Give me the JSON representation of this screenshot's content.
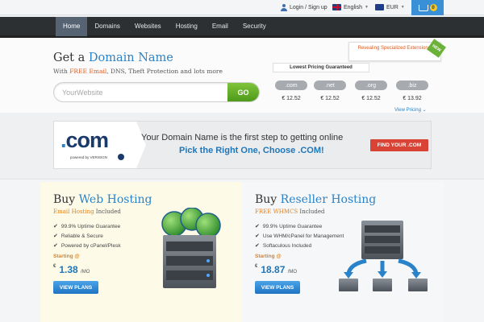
{
  "topbar": {
    "login": "Login / Sign up",
    "language": "English",
    "currency": "EUR",
    "cart_count": "0"
  },
  "nav": {
    "items": [
      "Home",
      "Domains",
      "Websites",
      "Hosting",
      "Email",
      "Security"
    ],
    "active": "Home"
  },
  "domain": {
    "title_pre": "Get a",
    "title_accent": "Domain Name",
    "sub_pre": "With",
    "sub_red": "FREE Email",
    "sub_post": ", DNS, Theft Protection and lots more",
    "search_placeholder": "YourWebsite",
    "go_label": "GO",
    "pricing_header": "Lowest Pricing Guaranteed",
    "tlds": [
      {
        "ext": ".com",
        "price": "€ 12.52"
      },
      {
        "ext": ".net",
        "price": "€ 12.52"
      },
      {
        "ext": ".org",
        "price": "€ 12.52"
      },
      {
        "ext": ".biz",
        "price": "€ 13.92"
      }
    ],
    "view_pricing": "View Pricing ⌄",
    "promo_text": "Revealing Specialized Extensions!",
    "new_label": "NEW"
  },
  "com_banner": {
    "logo_dot": ".",
    "logo_text": "com",
    "powered": "powered by VERISIGN",
    "line1": "Your Domain Name is the first step to getting online",
    "line2": "Pick the Right One, Choose .COM!",
    "cta": "FIND YOUR .COM"
  },
  "web_hosting": {
    "title_pre": "Buy",
    "title_accent": "Web Hosting",
    "sub_orange": "Email Hosting",
    "sub_post": " Included",
    "features": [
      "99.9% Uptime Guarantee",
      "Reliable & Secure",
      "Powered by cPanel/Plesk"
    ],
    "starting": "Starting @",
    "currency": "€",
    "price": "1.38",
    "per": "/MO",
    "cta": "VIEW PLANS"
  },
  "reseller_hosting": {
    "title_pre": "Buy",
    "title_accent": "Reseller Hosting",
    "sub_orange": "FREE WHMCS",
    "sub_post": " Included",
    "features": [
      "99.9% Uptime Guarantee",
      "Use WHM/cPanel for Management",
      "Softaculous Included"
    ],
    "starting": "Starting @",
    "currency": "€",
    "price": "18.87",
    "per": "/MO",
    "cta": "VIEW PLANS"
  },
  "colors": {
    "accent_blue": "#2a83c9",
    "nav_bg": "#2d3033",
    "go_green": "#5aa623",
    "cta_red": "#d94335"
  }
}
